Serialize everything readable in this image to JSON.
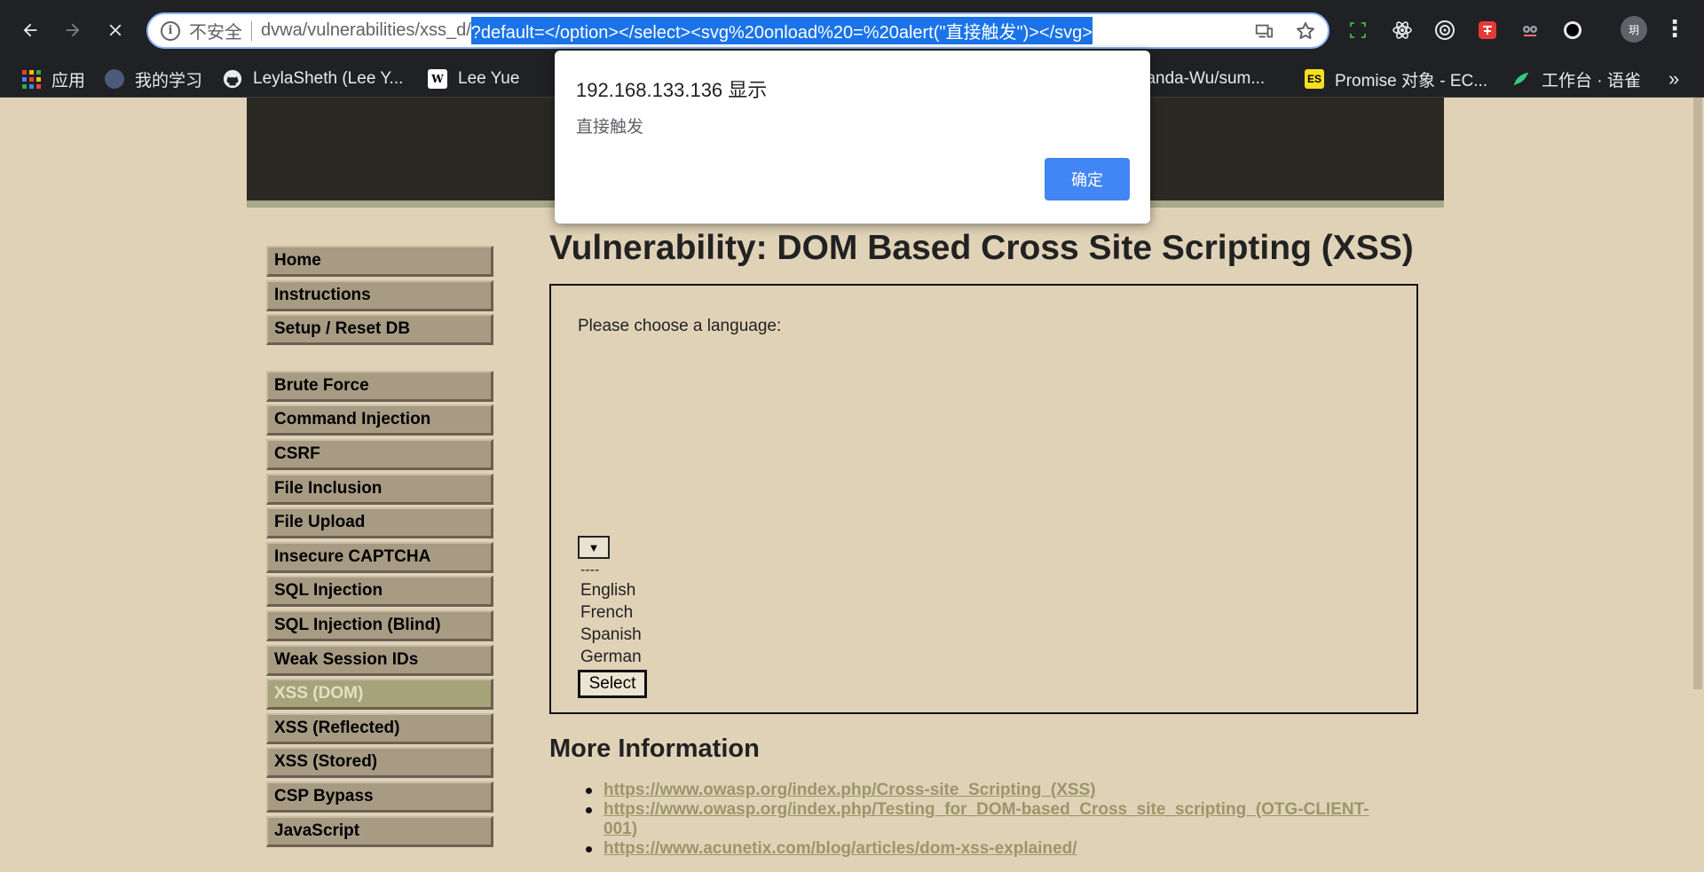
{
  "browser": {
    "security_label": "不安全",
    "url_plain": "dvwa/vulnerabilities/xss_d/",
    "url_selected": "?default=</option></select><svg%20onload%20=%20alert(\"直接触发\")></svg>",
    "avatar_text": "玥",
    "bookmarks": [
      {
        "label": "应用",
        "icon": "apps-grid-icon"
      },
      {
        "label": "我的学习",
        "icon": "globe-icon"
      },
      {
        "label": "LeylaSheth (Lee Y...",
        "icon": "github-icon"
      },
      {
        "label": "Lee Yue",
        "icon": "w-icon"
      },
      {
        "label": "lianda-Wu/sum...",
        "icon": "github-icon"
      },
      {
        "label": "Promise 对象 - EC...",
        "icon": "es-icon"
      },
      {
        "label": "工作台 · 语雀",
        "icon": "yuque-icon"
      }
    ],
    "more_bookmarks": "»"
  },
  "dialog": {
    "origin": "192.168.133.136 显示",
    "message": "直接触发",
    "ok_label": "确定"
  },
  "menu": {
    "group1": [
      "Home",
      "Instructions",
      "Setup / Reset DB"
    ],
    "group2": [
      "Brute Force",
      "Command Injection",
      "CSRF",
      "File Inclusion",
      "File Upload",
      "Insecure CAPTCHA",
      "SQL Injection",
      "SQL Injection (Blind)",
      "Weak Session IDs",
      "XSS (DOM)",
      "XSS (Reflected)",
      "XSS (Stored)",
      "CSP Bypass",
      "JavaScript"
    ],
    "active": "XSS (DOM)"
  },
  "main": {
    "title": "Vulnerability: DOM Based Cross Site Scripting (XSS)",
    "choose_label": "Please choose a language:",
    "select_arrow": "▼",
    "options": [
      "----",
      "English",
      "French",
      "Spanish",
      "German"
    ],
    "select_button": "Select",
    "more_info_title": "More Information",
    "links": [
      "https://www.owasp.org/index.php/Cross-site_Scripting_(XSS)",
      "https://www.owasp.org/index.php/Testing_for_DOM-based_Cross_site_scripting_(OTG-CLIENT-001)",
      "https://www.acunetix.com/blog/articles/dom-xss-explained/"
    ]
  },
  "colors": {
    "page_bg": "#e0d2b7",
    "header_bg": "#2a2a22",
    "menu_item_bg": "#a89b84",
    "menu_active_bg": "#a6a37a",
    "link_color": "#9a966a",
    "dialog_button": "#4285f4",
    "url_highlight": "#1a73e8"
  }
}
